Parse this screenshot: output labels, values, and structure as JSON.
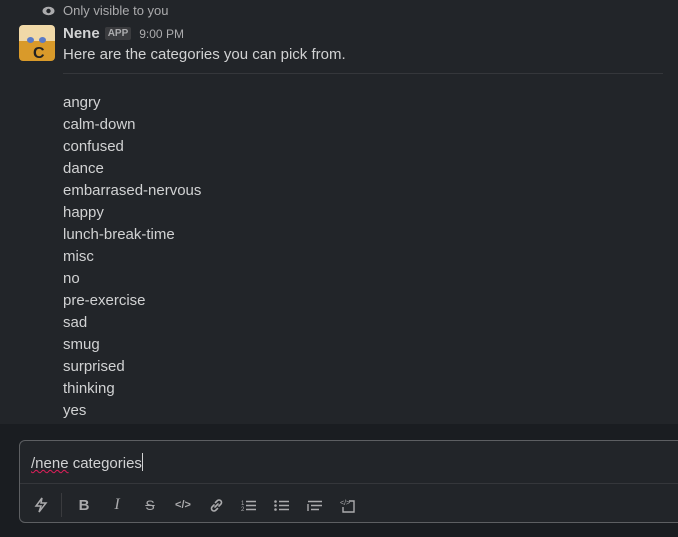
{
  "message": {
    "visibility_note": "Only visible to you",
    "sender": "Nene",
    "badge": "APP",
    "time": "9:00 PM",
    "text": "Here are the categories you can pick from.",
    "categories": [
      "angry",
      "calm-down",
      "confused",
      "dance",
      "embarrased-nervous",
      "happy",
      "lunch-break-time",
      "misc",
      "no",
      "pre-exercise",
      "sad",
      "smug",
      "surprised",
      "thinking",
      "yes"
    ]
  },
  "composer": {
    "command": "/nene",
    "args": " categories",
    "toolbar": [
      "shortcuts-icon",
      "bold-icon",
      "italic-icon",
      "strikethrough-icon",
      "code-icon",
      "link-icon",
      "ordered-list-icon",
      "bulleted-list-icon",
      "blockquote-icon",
      "code-block-icon"
    ]
  }
}
